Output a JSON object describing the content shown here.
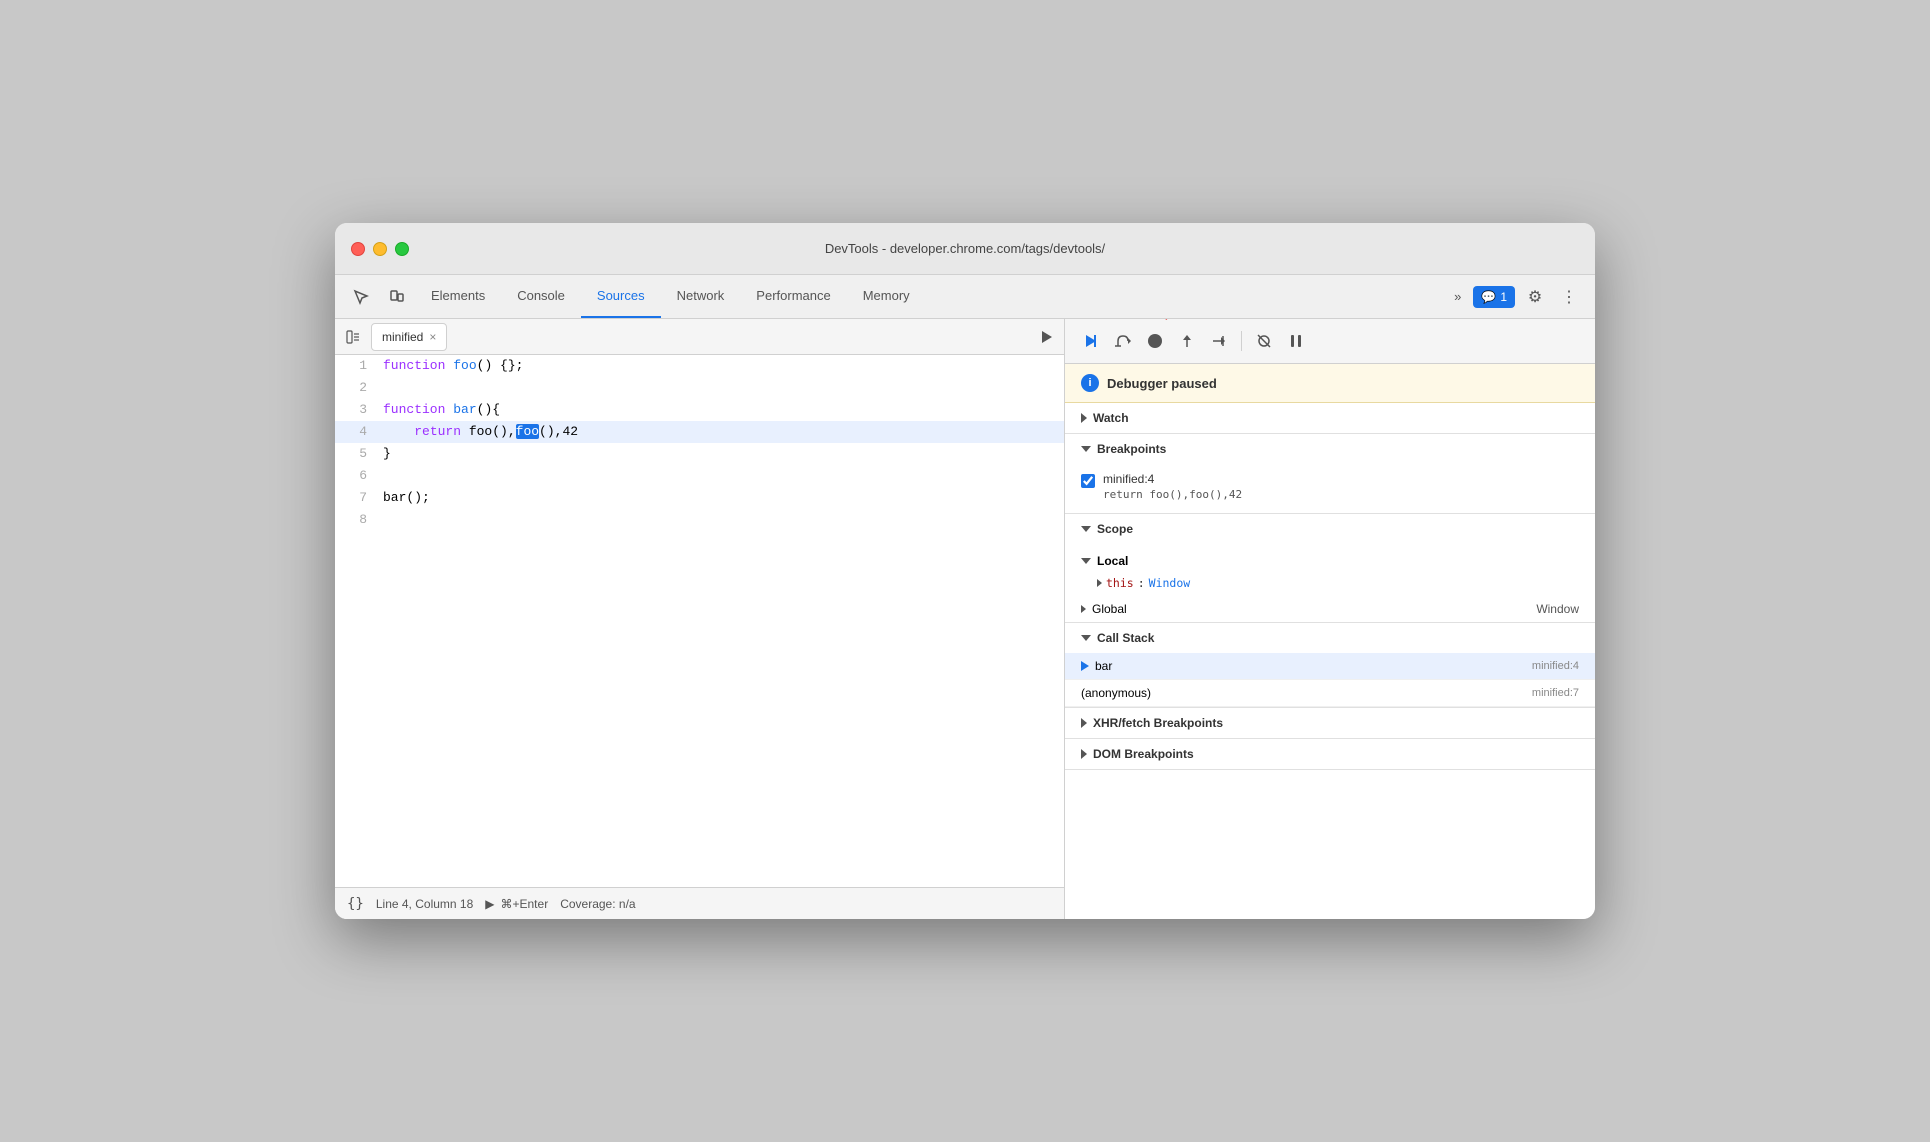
{
  "window": {
    "title": "DevTools - developer.chrome.com/tags/devtools/"
  },
  "tabs": [
    {
      "id": "elements",
      "label": "Elements",
      "active": false
    },
    {
      "id": "console",
      "label": "Console",
      "active": false
    },
    {
      "id": "sources",
      "label": "Sources",
      "active": true
    },
    {
      "id": "network",
      "label": "Network",
      "active": false
    },
    {
      "id": "performance",
      "label": "Performance",
      "active": false
    },
    {
      "id": "memory",
      "label": "Memory",
      "active": false
    }
  ],
  "toolbar": {
    "more_label": "»",
    "badge_icon": "💬",
    "badge_count": "1",
    "gear_icon": "⚙",
    "kebab_icon": "⋮"
  },
  "file_panel": {
    "toggle_icon": "▶",
    "tab_name": "minified",
    "close_icon": "×",
    "run_icon": "▶"
  },
  "code": {
    "lines": [
      {
        "num": 1,
        "content": "function foo() {};",
        "highlighted": false
      },
      {
        "num": 2,
        "content": "",
        "highlighted": false
      },
      {
        "num": 3,
        "content": "function bar(){",
        "highlighted": false
      },
      {
        "num": 4,
        "content": "    return foo(),foo(),42",
        "highlighted": true
      },
      {
        "num": 5,
        "content": "}",
        "highlighted": false
      },
      {
        "num": 6,
        "content": "",
        "highlighted": false
      },
      {
        "num": 7,
        "content": "bar();",
        "highlighted": false
      },
      {
        "num": 8,
        "content": "",
        "highlighted": false
      }
    ]
  },
  "status_bar": {
    "format_icon": "{}",
    "position": "Line 4, Column 18",
    "run_icon": "▶",
    "shortcut": "⌘+Enter",
    "coverage": "Coverage: n/a"
  },
  "debug_toolbar": {
    "resume_icon": "▶",
    "step_over_icon": "↺",
    "step_into_icon": "●",
    "step_out_icon": "↑",
    "step_icon": "→",
    "deactivate_icon": "⟋",
    "pause_icon": "⏸"
  },
  "right_panel": {
    "debugger_paused": "Debugger paused",
    "watch": {
      "label": "Watch",
      "expanded": false
    },
    "breakpoints": {
      "label": "Breakpoints",
      "expanded": true,
      "items": [
        {
          "location": "minified:4",
          "code": "return foo(),foo(),42",
          "enabled": true
        }
      ]
    },
    "scope": {
      "label": "Scope",
      "expanded": true,
      "local": {
        "label": "Local",
        "expanded": true,
        "props": [
          {
            "key": "this",
            "colon": ":",
            "val": "Window"
          }
        ]
      },
      "global": {
        "label": "Global",
        "val": "Window"
      }
    },
    "call_stack": {
      "label": "Call Stack",
      "expanded": true,
      "items": [
        {
          "fn": "bar",
          "location": "minified:4",
          "active": true
        },
        {
          "fn": "(anonymous)",
          "location": "minified:7",
          "active": false
        }
      ]
    },
    "xhr_breakpoints": {
      "label": "XHR/fetch Breakpoints",
      "expanded": false
    },
    "dom_breakpoints": {
      "label": "DOM Breakpoints",
      "expanded": false
    }
  }
}
